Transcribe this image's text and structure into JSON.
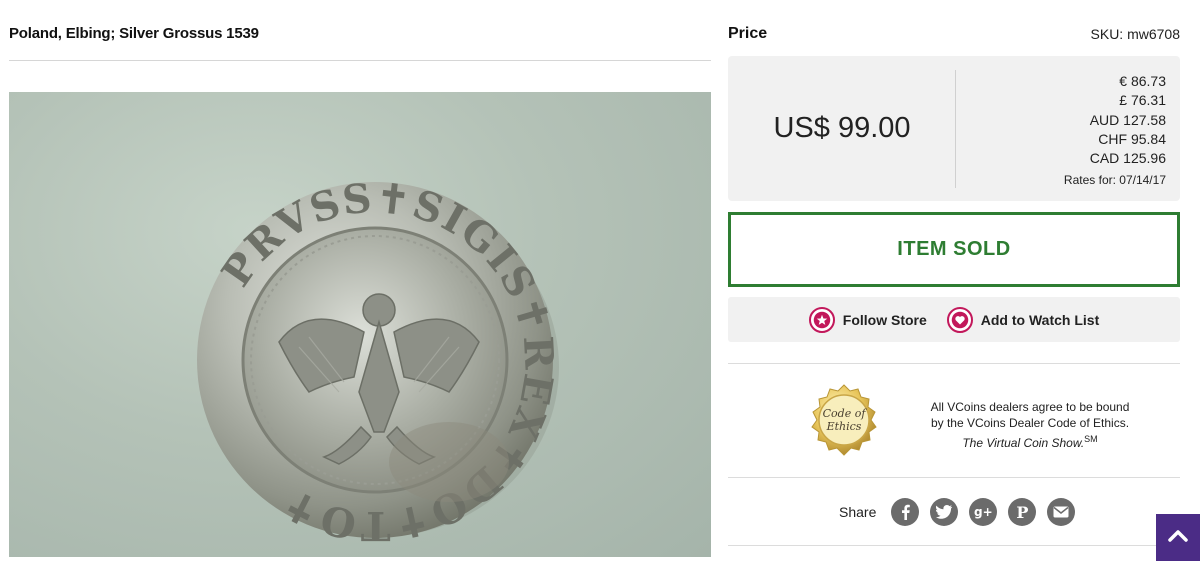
{
  "item": {
    "title": "Poland, Elbing; Silver Grossus 1539"
  },
  "price_panel": {
    "label": "Price",
    "sku": "SKU: mw6708",
    "main_price": "US$ 99.00",
    "rates": [
      "€ 86.73",
      "£ 76.31",
      "AUD 127.58",
      "CHF 95.84",
      "CAD 125.96"
    ],
    "rates_date": "Rates for: 07/14/17"
  },
  "status": {
    "sold_label": "ITEM SOLD",
    "sold_color": "#2e7d32"
  },
  "actions": {
    "follow_label": "Follow Store",
    "follow_icon": "star-icon",
    "watch_label": "Add to Watch List",
    "watch_icon": "heart-icon",
    "accent_color": "#c2185b"
  },
  "ethics": {
    "seal_line1": "Code of",
    "seal_line2": "Ethics",
    "text_line1": "All VCoins dealers agree to be bound",
    "text_line2": "by the VCoins Dealer Code of Ethics.",
    "text_line3": "The Virtual Coin Show.",
    "text_sup": "SM"
  },
  "share": {
    "label": "Share",
    "icons": [
      "facebook-icon",
      "twitter-icon",
      "google-plus-icon",
      "pinterest-icon",
      "email-icon"
    ]
  },
  "coin_legend": "PRVSS✝SIGIS✝REX✝DO✝TO✝",
  "scroll_top_color": "#4b2c86"
}
